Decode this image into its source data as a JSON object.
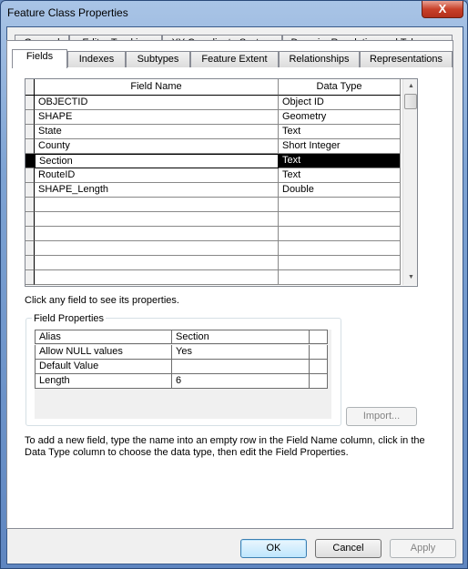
{
  "window": {
    "title": "Feature Class Properties",
    "close_label": "X"
  },
  "tabs_row1": [
    {
      "label": "General"
    },
    {
      "label": "Editor Tracking"
    },
    {
      "label": "XY Coordinate System"
    },
    {
      "label": "Domain, Resolution and Tolerance"
    }
  ],
  "tabs_row2": [
    {
      "label": "Fields",
      "active": true
    },
    {
      "label": "Indexes"
    },
    {
      "label": "Subtypes"
    },
    {
      "label": "Feature Extent"
    },
    {
      "label": "Relationships"
    },
    {
      "label": "Representations"
    }
  ],
  "fields_grid": {
    "headers": {
      "field_name": "Field Name",
      "data_type": "Data Type"
    },
    "rows": [
      {
        "name": "OBJECTID",
        "type": "Object ID"
      },
      {
        "name": "SHAPE",
        "type": "Geometry"
      },
      {
        "name": "State",
        "type": "Text"
      },
      {
        "name": "County",
        "type": "Short Integer"
      },
      {
        "name": "Section",
        "type": "Text",
        "selected": true
      },
      {
        "name": "RouteID",
        "type": "Text"
      },
      {
        "name": "SHAPE_Length",
        "type": "Double"
      },
      {
        "name": "",
        "type": ""
      },
      {
        "name": "",
        "type": ""
      },
      {
        "name": "",
        "type": ""
      },
      {
        "name": "",
        "type": ""
      },
      {
        "name": "",
        "type": ""
      },
      {
        "name": "",
        "type": ""
      }
    ]
  },
  "hint": "Click any field to see its properties.",
  "field_properties": {
    "label": "Field Properties",
    "rows": [
      {
        "prop": "Alias",
        "value": "Section"
      },
      {
        "prop": "Allow NULL values",
        "value": "Yes"
      },
      {
        "prop": "Default Value",
        "value": ""
      },
      {
        "prop": "Length",
        "value": "6"
      }
    ]
  },
  "import_label": "Import...",
  "help_text": "To add a new field, type the name into an empty row in the Field Name column, click in the Data Type column to choose the data type, then edit the Field Properties.",
  "buttons": {
    "ok": "OK",
    "cancel": "Cancel",
    "apply": "Apply"
  }
}
